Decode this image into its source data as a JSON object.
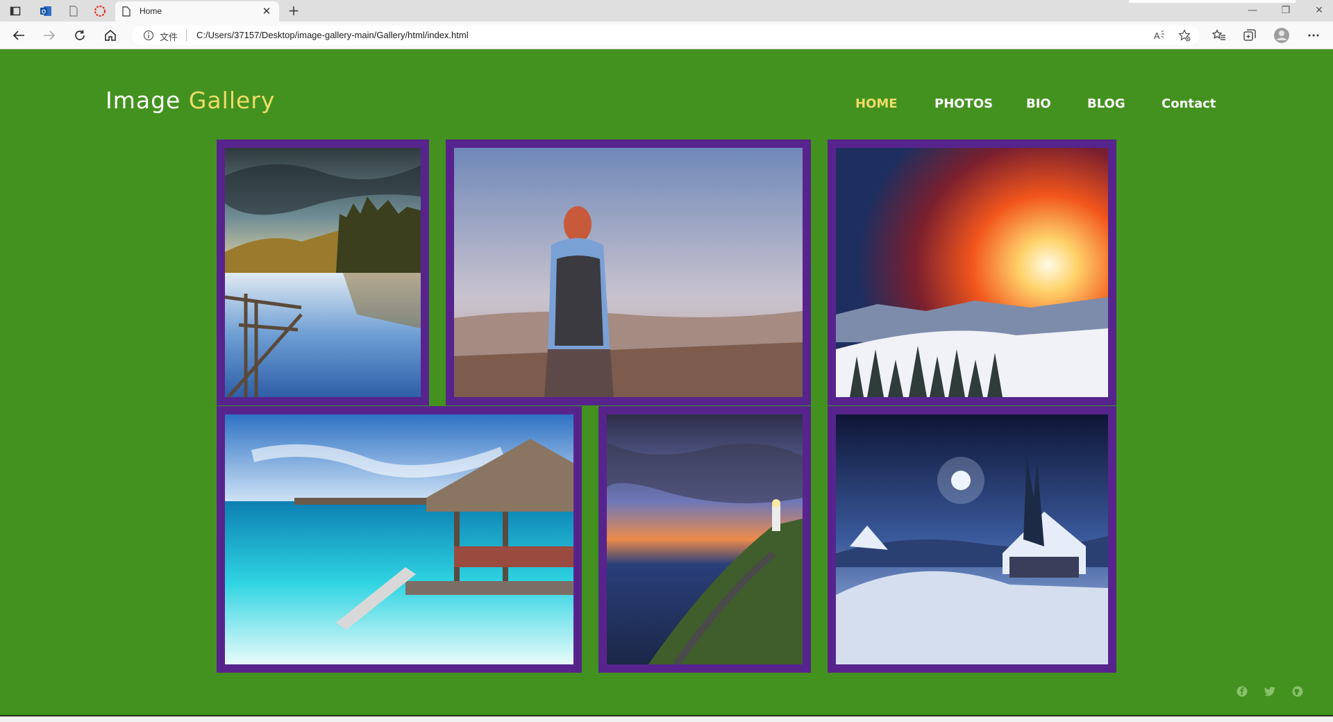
{
  "browser": {
    "tab_title": "Home",
    "address_file_label": "文件",
    "url": "C:/Users/37157/Desktop/image-gallery-main/Gallery/html/index.html",
    "icons": {
      "tab_actions": "tab-actions-icon",
      "outlook": "outlook-icon",
      "page": "page-icon",
      "opera": "opera-icon",
      "back": "back-arrow-icon",
      "forward": "forward-arrow-icon",
      "refresh": "refresh-icon",
      "home": "home-icon",
      "read_aloud": "read-aloud-icon",
      "add_favorite": "add-favorite-icon",
      "favorites": "favorites-icon",
      "collections": "collections-icon",
      "profile": "profile-icon",
      "menu": "more-menu-icon"
    },
    "window_controls": [
      "minimize",
      "restore",
      "close"
    ]
  },
  "site": {
    "brand_first": "Image",
    "brand_second": "Gallery",
    "nav": [
      {
        "label": "HOME",
        "active": true
      },
      {
        "label": "PHOTOS",
        "active": false
      },
      {
        "label": "BIO",
        "active": false
      },
      {
        "label": "BLOG",
        "active": false
      },
      {
        "label": "Contact",
        "active": false
      }
    ],
    "photos": [
      {
        "name": "lake-photo",
        "description": "lake with pier and forest"
      },
      {
        "name": "hiker-photo",
        "description": "girl with backpack overlooking city"
      },
      {
        "name": "sunset-mountains-photo",
        "description": "sunset over snowy forest"
      },
      {
        "name": "beach-hut-photo",
        "description": "turquoise sea with thatched hut"
      },
      {
        "name": "lighthouse-photo",
        "description": "lighthouse on cliff at sunset"
      },
      {
        "name": "winter-night-photo",
        "description": "snowy village under full moon"
      }
    ],
    "social": [
      "facebook-icon",
      "twitter-icon",
      "github-icon"
    ]
  },
  "colors": {
    "page_background": "#43921f",
    "frame": "#57248e",
    "accent": "#efdc6a",
    "nav_text": "#ffffff"
  }
}
